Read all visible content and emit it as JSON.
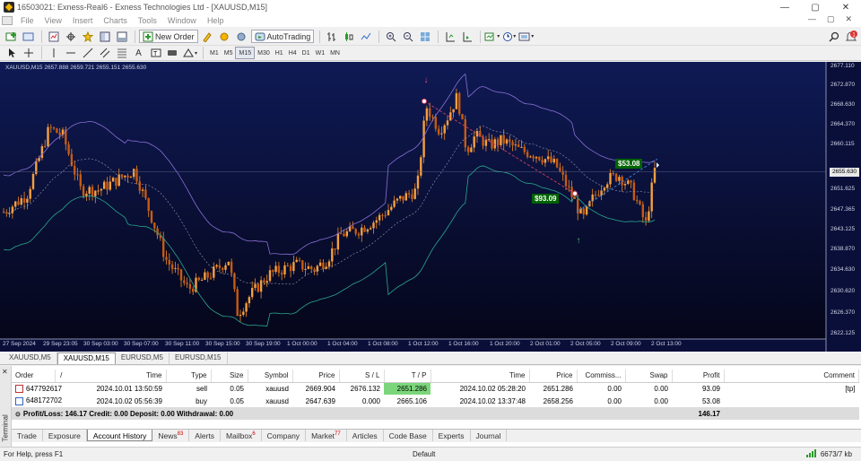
{
  "window": {
    "title": "16503021: Exness-Real6 - Exness Technologies Ltd - [XAUUSD,M15]",
    "controls": [
      "—",
      "▢",
      "✕"
    ]
  },
  "menu": [
    "File",
    "View",
    "Insert",
    "Charts",
    "Tools",
    "Window",
    "Help"
  ],
  "mdi_controls": [
    "—",
    "▢",
    "✕"
  ],
  "toolbar": {
    "new_order": "New Order",
    "autotrading": "AutoTrading"
  },
  "timeframes": [
    "M1",
    "M5",
    "M15",
    "M30",
    "H1",
    "H4",
    "D1",
    "W1",
    "MN"
  ],
  "active_timeframe": "M15",
  "chart": {
    "ohlc": "XAUUSD,M15  2657.888 2659.721 2655.151 2655.630",
    "current_price": "2655.630",
    "price_labels": [
      "2677.110",
      "2672.870",
      "2668.630",
      "2664.370",
      "2660.115",
      "2655.630",
      "2651.625",
      "2647.365",
      "2643.125",
      "2638.870",
      "2634.630",
      "2630.620",
      "2626.370",
      "2622.125"
    ],
    "time_labels": [
      "27 Sep 2024",
      "29 Sep 23:05",
      "30 Sep 03:00",
      "30 Sep 07:00",
      "30 Sep 11:00",
      "30 Sep 15:00",
      "30 Sep 19:00",
      "1 Oct 00:00",
      "1 Oct 04:00",
      "1 Oct 08:00",
      "1 Oct 12:00",
      "1 Oct 16:00",
      "1 Oct 20:00",
      "2 Oct 01:00",
      "2 Oct 05:00",
      "2 Oct 09:00",
      "2 Oct 13:00"
    ],
    "profit_labels": [
      "$93.09",
      "$53.08"
    ],
    "colors": {
      "background": "#0a0f3a",
      "candle": "#f08a24",
      "band": "#8a6fd6",
      "lower_band": "#2aa88f"
    }
  },
  "chart_tabs": [
    "XAUUSD,M5",
    "XAUUSD,M15",
    "EURUSD,M5",
    "EURUSD,M15"
  ],
  "active_chart_tab": "XAUUSD,M15",
  "terminal": {
    "side_label": "Terminal",
    "columns": [
      "Order",
      "/",
      "Time",
      "Type",
      "Size",
      "Symbol",
      "Price",
      "S / L",
      "T / P",
      "Time",
      "Price",
      "Commiss...",
      "Swap",
      "Profit",
      "Comment"
    ],
    "rows": [
      [
        "647792617",
        "2024.10.01 13:50:59",
        "sell",
        "0.05",
        "xauusd",
        "2669.904",
        "2676.132",
        "2651.286",
        "2024.10.02 05:28:20",
        "2651.286",
        "0.00",
        "0.00",
        "93.09",
        "[tp]"
      ],
      [
        "648172702",
        "2024.10.02 05:56:39",
        "buy",
        "0.05",
        "xauusd",
        "2647.639",
        "0.000",
        "2665.106",
        "2024.10.02 13:37:48",
        "2658.256",
        "0.00",
        "0.00",
        "53.08",
        ""
      ]
    ],
    "summary": "Profit/Loss: 146.17  Credit: 0.00  Deposit: 0.00  Withdrawal: 0.00",
    "summary_total": "146.17"
  },
  "bottom_tabs": [
    {
      "label": "Trade",
      "badge": ""
    },
    {
      "label": "Exposure",
      "badge": ""
    },
    {
      "label": "Account History",
      "badge": ""
    },
    {
      "label": "News",
      "badge": "83"
    },
    {
      "label": "Alerts",
      "badge": ""
    },
    {
      "label": "Mailbox",
      "badge": "6"
    },
    {
      "label": "Company",
      "badge": ""
    },
    {
      "label": "Market",
      "badge": "77"
    },
    {
      "label": "Articles",
      "badge": ""
    },
    {
      "label": "Code Base",
      "badge": ""
    },
    {
      "label": "Experts",
      "badge": ""
    },
    {
      "label": "Journal",
      "badge": ""
    }
  ],
  "active_bottom_tab": "Account History",
  "status": {
    "help": "For Help, press F1",
    "profile": "Default",
    "traffic": "6673/7 kb"
  },
  "notifications": {
    "count": "1"
  }
}
